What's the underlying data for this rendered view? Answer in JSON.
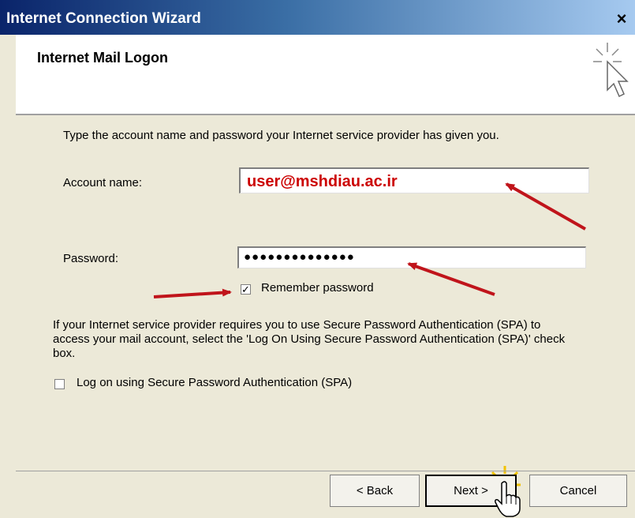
{
  "window": {
    "title": "Internet Connection Wizard",
    "close_label": "×"
  },
  "header": {
    "title": "Internet Mail Logon"
  },
  "content": {
    "instruction": "Type the account name and password your Internet service provider has given you.",
    "account": {
      "label": "Account name:",
      "value": "user@mshdiau.ac.ir"
    },
    "password": {
      "label": "Password:",
      "value": "●●●●●●●●●●●●●●"
    },
    "remember": {
      "label": "Remember password",
      "checked": true,
      "mark": "✓"
    },
    "spa_info": "If your Internet service provider requires you to use Secure Password Authentication (SPA) to access your mail account, select the 'Log On Using Secure Password Authentication (SPA)' check box.",
    "spa": {
      "label": "Log on using Secure Password Authentication (SPA)",
      "checked": false
    }
  },
  "buttons": {
    "back": "< Back",
    "next": "Next >",
    "cancel": "Cancel"
  },
  "annotation_color": "#C0141B"
}
